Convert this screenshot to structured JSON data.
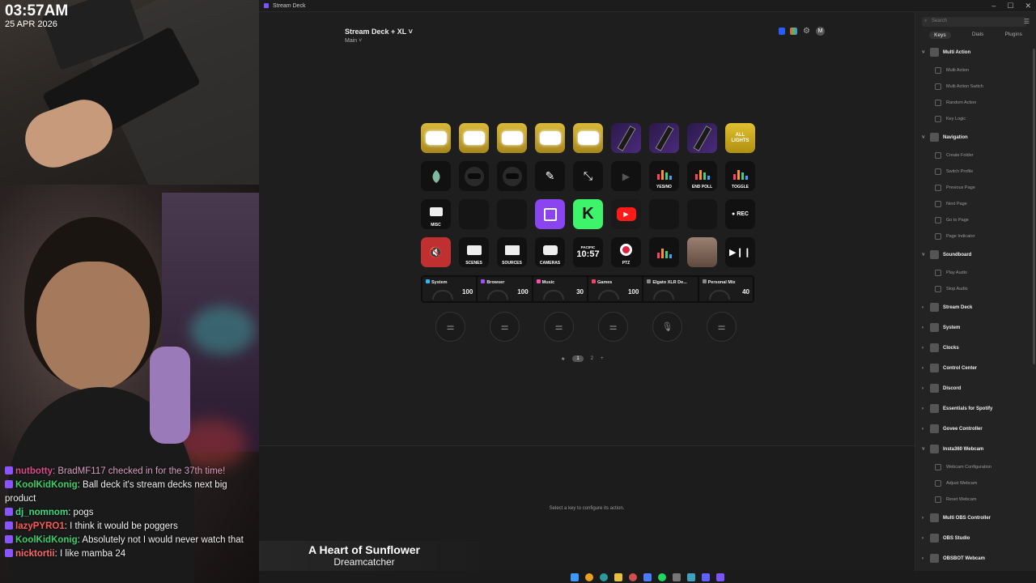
{
  "overlay": {
    "time": "03:57AM",
    "date": "25 APR 2026"
  },
  "chat": [
    {
      "user": "nutbotty",
      "text": ": BradMF117 checked in for the 37th time!",
      "user_color": "#d94c8a",
      "text_color": "#d8a0c0"
    },
    {
      "user": "KoolKidKonig",
      "text": ": Ball deck it's stream decks next big product",
      "user_color": "#39d06b",
      "text_color": "#f1f1f1"
    },
    {
      "user": "dj_nomnom",
      "text": ": pogs",
      "user_color": "#3ddc84",
      "text_color": "#f1f1f1"
    },
    {
      "user": "lazyPYRO1",
      "text": ": I think it would be poggers",
      "user_color": "#ff5a5a",
      "text_color": "#f1f1f1"
    },
    {
      "user": "KoolKidKonig",
      "text": ": Absolutely not I would never watch that",
      "user_color": "#39d06b",
      "text_color": "#f1f1f1"
    },
    {
      "user": "nicktortii",
      "text": ": I like mamba 24",
      "user_color": "#ff6a6a",
      "text_color": "#f1f1f1"
    }
  ],
  "window": {
    "title": "Stream Deck",
    "controls": [
      "–",
      "☐",
      "✕"
    ]
  },
  "device": {
    "name": "Stream Deck + XL",
    "profile": "Main"
  },
  "account_initial": "M",
  "keys": {
    "all_lights": "ALL\nLIGHTS",
    "yes_no": "YES/NO",
    "end_poll": "END POLL",
    "toggle": "TOGGLE",
    "misc": "MISC",
    "rec": "● REC",
    "scenes": "SCENES",
    "sources": "SOURCES",
    "cameras": "CAMERAS",
    "pacific": "PACIFIC",
    "clock": "10:57",
    "ptz": "PTZ"
  },
  "dials": [
    {
      "name": "System",
      "value": "100",
      "color": "#2fb4ff"
    },
    {
      "name": "Browser",
      "value": "100",
      "color": "#a050ff"
    },
    {
      "name": "Music",
      "value": "30",
      "color": "#ff4fb0"
    },
    {
      "name": "Games",
      "value": "100",
      "color": "#ff4060"
    },
    {
      "name": "Elgato XLR De...",
      "value": "",
      "color": "#888888"
    },
    {
      "name": "Personal Mix",
      "value": "40",
      "color": "#888888"
    }
  ],
  "pages": [
    "1",
    "2",
    "+"
  ],
  "hint": "Select a key to configure its action.",
  "sidebar": {
    "search_placeholder": "Search",
    "tabs": [
      "Keys",
      "Dials",
      "Plugins"
    ],
    "items": [
      {
        "type": "group",
        "label": "Multi Action",
        "open": true
      },
      {
        "type": "action",
        "label": "Multi Action"
      },
      {
        "type": "action",
        "label": "Multi Action Switch"
      },
      {
        "type": "action",
        "label": "Random Action"
      },
      {
        "type": "action",
        "label": "Key Logic"
      },
      {
        "type": "group",
        "label": "Navigation",
        "open": true
      },
      {
        "type": "action",
        "label": "Create Folder"
      },
      {
        "type": "action",
        "label": "Switch Profile"
      },
      {
        "type": "action",
        "label": "Previous Page"
      },
      {
        "type": "action",
        "label": "Next Page"
      },
      {
        "type": "action",
        "label": "Go to Page"
      },
      {
        "type": "action",
        "label": "Page Indicator"
      },
      {
        "type": "group",
        "label": "Soundboard",
        "open": true
      },
      {
        "type": "action",
        "label": "Play Audio"
      },
      {
        "type": "action",
        "label": "Stop Audio"
      },
      {
        "type": "group",
        "label": "Stream Deck",
        "open": false
      },
      {
        "type": "group",
        "label": "System",
        "open": false
      },
      {
        "type": "group",
        "label": "Clocks",
        "open": false
      },
      {
        "type": "group",
        "label": "Control Center",
        "open": false
      },
      {
        "type": "group",
        "label": "Discord",
        "open": false
      },
      {
        "type": "group",
        "label": "Essentials for Spotify",
        "open": false
      },
      {
        "type": "group",
        "label": "Govee Controller",
        "open": false
      },
      {
        "type": "group",
        "label": "Insta360 Webcam",
        "open": true
      },
      {
        "type": "action",
        "label": "Webcam Configuration"
      },
      {
        "type": "action",
        "label": "Adjust Webcam"
      },
      {
        "type": "action",
        "label": "Reset Webcam"
      },
      {
        "type": "group",
        "label": "Multi OBS Controller",
        "open": false
      },
      {
        "type": "group",
        "label": "OBS Studio",
        "open": false
      },
      {
        "type": "group",
        "label": "OBSBOT Webcam",
        "open": false
      }
    ]
  },
  "now_playing": {
    "song": "A Heart of Sunflower",
    "artist": "Dreamcatcher"
  }
}
